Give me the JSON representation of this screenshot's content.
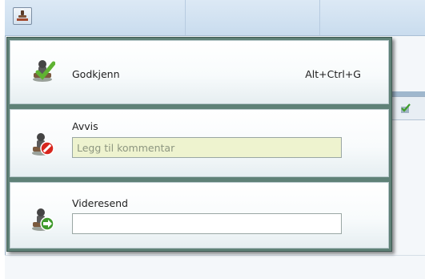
{
  "menu": {
    "approve": {
      "label": "Godkjenn",
      "shortcut": "Alt+Ctrl+G",
      "icon": "approve-stamp-icon"
    },
    "reject": {
      "label": "Avvis",
      "comment_placeholder": "Legg til kommentar",
      "comment_value": "",
      "icon": "reject-stamp-icon"
    },
    "forward": {
      "label": "Videresend",
      "comment_value": "",
      "icon": "forward-stamp-icon"
    }
  },
  "toolbar": {
    "stamp_button_icon": "stamp-icon"
  },
  "colors": {
    "menu_border": "#5f8177",
    "toolbar": "#c9dcee",
    "approve_check": "#5fb332",
    "reject_red": "#d7261e",
    "forward_green": "#3f9a2c",
    "input_highlight": "#eef3cf"
  }
}
